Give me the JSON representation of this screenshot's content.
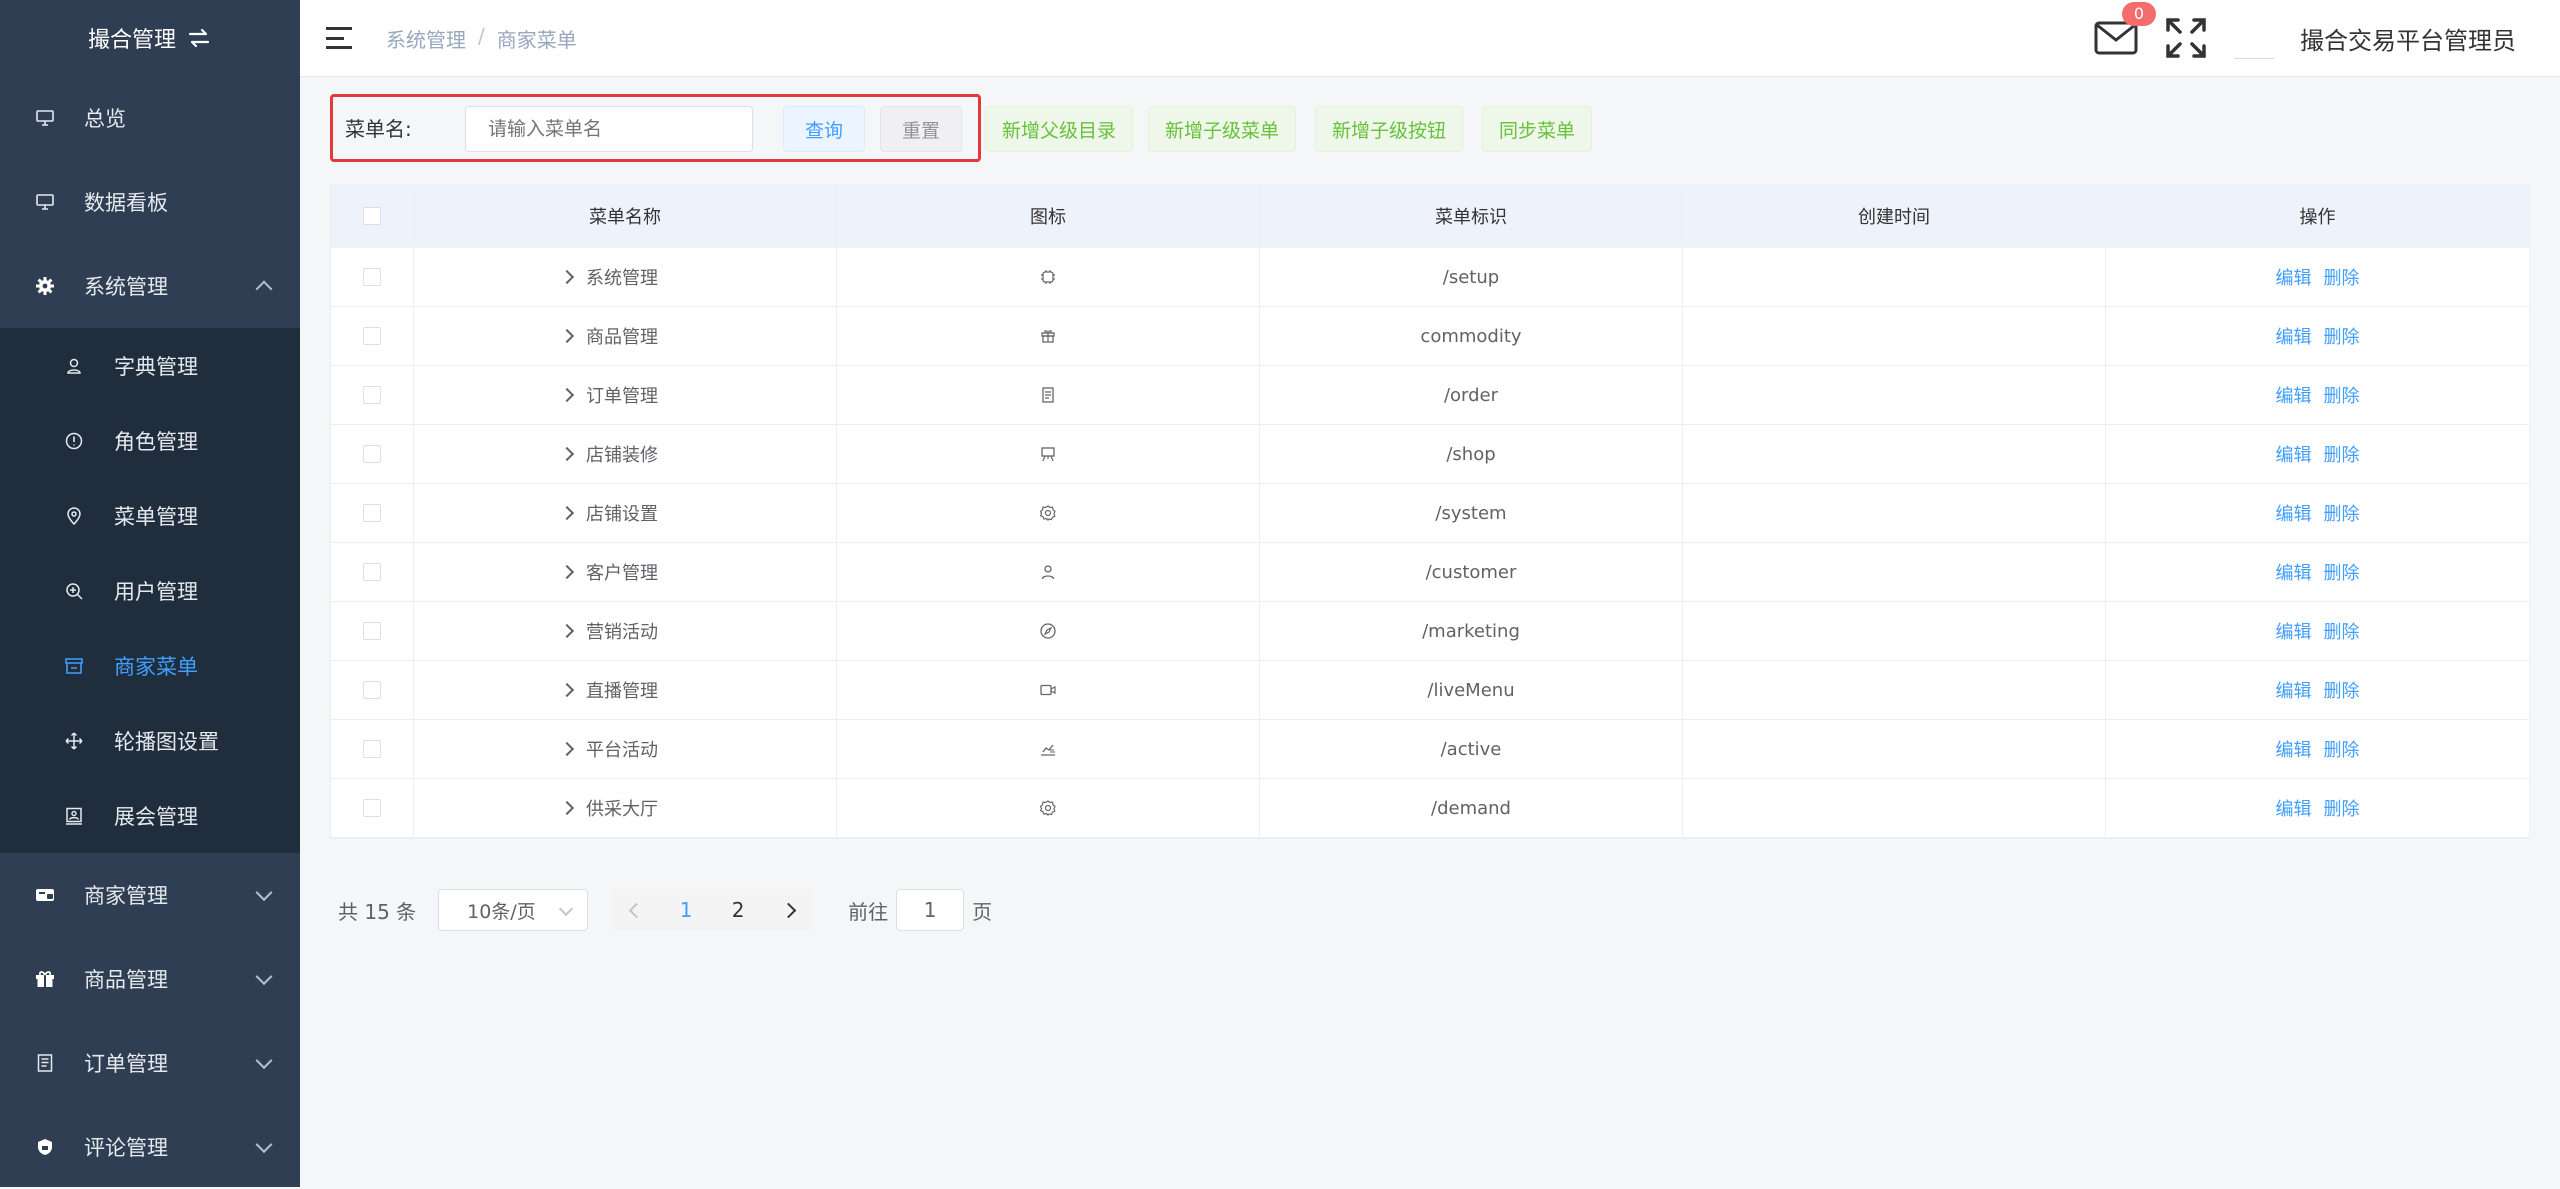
{
  "sidebar": {
    "brand": "撮合管理",
    "items": [
      {
        "label": "总览"
      },
      {
        "label": "数据看板"
      },
      {
        "label": "系统管理"
      }
    ],
    "submenu": [
      {
        "label": "字典管理"
      },
      {
        "label": "角色管理"
      },
      {
        "label": "菜单管理"
      },
      {
        "label": "用户管理"
      },
      {
        "label": "商家菜单"
      },
      {
        "label": "轮播图设置"
      },
      {
        "label": "展会管理"
      }
    ],
    "bottom_items": [
      {
        "label": "商家管理"
      },
      {
        "label": "商品管理"
      },
      {
        "label": "订单管理"
      },
      {
        "label": "评论管理"
      }
    ]
  },
  "header": {
    "breadcrumb": [
      "系统管理",
      "/",
      "商家菜单"
    ],
    "mail_count": "0",
    "username": "撮合交易平台管理员"
  },
  "search": {
    "label": "菜单名:",
    "placeholder": "请输入菜单名",
    "query": "查询",
    "reset": "重置",
    "add_parent": "新增父级目录",
    "add_child_menu": "新增子级菜单",
    "add_child_button": "新增子级按钮",
    "sync": "同步菜单"
  },
  "table": {
    "headers": [
      "菜单名称",
      "图标",
      "菜单标识",
      "创建时间",
      "操作"
    ],
    "rows": [
      {
        "name": "系统管理",
        "key": "/setup",
        "icon": "chip-icon"
      },
      {
        "name": "商品管理",
        "key": "commodity",
        "icon": "gift-icon"
      },
      {
        "name": "订单管理",
        "key": "/order",
        "icon": "document-icon"
      },
      {
        "name": "店铺装修",
        "key": "/shop",
        "icon": "easel-icon"
      },
      {
        "name": "店铺设置",
        "key": "/system",
        "icon": "cog-icon"
      },
      {
        "name": "客户管理",
        "key": "/customer",
        "icon": "user-icon"
      },
      {
        "name": "营销活动",
        "key": "/marketing",
        "icon": "compass-icon"
      },
      {
        "name": "直播管理",
        "key": "/liveMenu",
        "icon": "video-icon"
      },
      {
        "name": "平台活动",
        "key": "/active",
        "icon": "chart-icon"
      },
      {
        "name": "供采大厅",
        "key": "/demand",
        "icon": "cog-icon"
      }
    ],
    "edit": "编辑",
    "delete": "删除"
  },
  "pagination": {
    "total": "共 15 条",
    "page_size": "10条/页",
    "pages": [
      "1",
      "2"
    ],
    "goto": "前往",
    "current": "1",
    "page_unit": "页"
  },
  "colors": {
    "sidebar_bg": "#2f3e53",
    "submenu_bg": "#1f2d3d",
    "accent": "#409eff",
    "green": "#67c23a",
    "highlight": "#e4393c"
  }
}
